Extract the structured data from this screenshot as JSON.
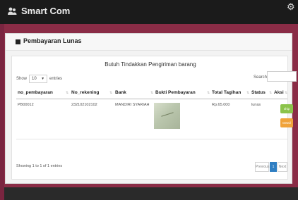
{
  "app": {
    "title": "Smart Com",
    "settings_icon": "gear-icon"
  },
  "panel": {
    "title": "Pembayaran Lunas",
    "caption": "Butuh Tindakkan Pengiriman barang"
  },
  "controls": {
    "show_label": "Show",
    "page_length": "10",
    "entries_label": "entries",
    "search_label": "Search:"
  },
  "table": {
    "columns": [
      "no_pembayaran",
      "No_rekening",
      "Bank",
      "Bukti Pembayaran",
      "Total Tagihan",
      "Status",
      "Aksi"
    ],
    "rows": [
      {
        "no_pembayaran": "PB00012",
        "no_rekening": "232102102102",
        "bank": "MANDIRI SYARIAH",
        "total_tagihan": "Rp.65.000",
        "status": "lunas",
        "action_primary": "ship",
        "action_secondary": "Detail"
      }
    ]
  },
  "footer": {
    "info": "Showing 1 to 1 of 1 entries",
    "prev": "Previous",
    "page": "1",
    "next": "Next"
  },
  "colors": {
    "accent": "#2f7ec2",
    "action_green": "#8bc34a",
    "action_orange": "#f0a33a",
    "frame": "#8a2c46"
  }
}
